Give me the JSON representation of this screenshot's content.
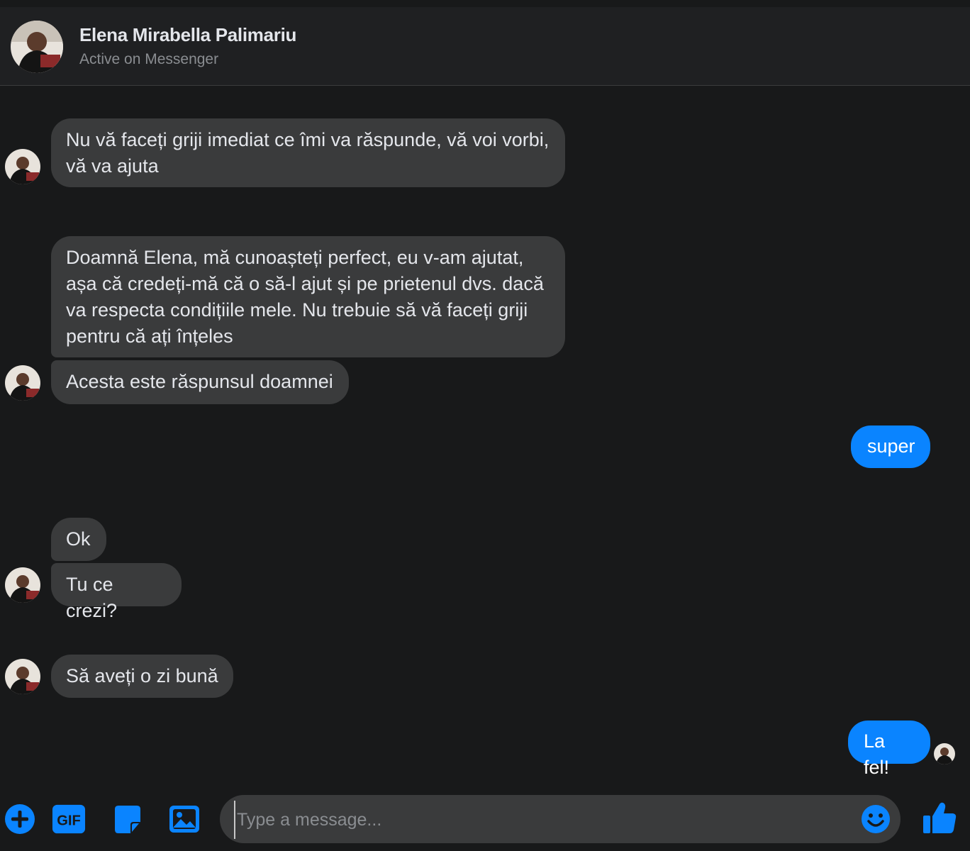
{
  "header": {
    "name": "Elena Mirabella Palimariu",
    "status": "Active on Messenger"
  },
  "messages": [
    {
      "direction": "in",
      "text": "Nu vă faceți griji imediat ce îmi va răspunde, vă voi vorbi, vă va ajuta"
    },
    {
      "direction": "in",
      "text": "Doamnă Elena, mă cunoașteți perfect, eu v-am ajutat, așa că credeți-mă că o să-l ajut și pe prietenul dvs. dacă va respecta condițiile mele. Nu trebuie să vă faceți griji pentru că ați înțeles"
    },
    {
      "direction": "in",
      "text": "Acesta este răspunsul doamnei"
    },
    {
      "direction": "out",
      "text": "super"
    },
    {
      "direction": "in",
      "text": "Ok"
    },
    {
      "direction": "in",
      "text": "Tu ce crezi?"
    },
    {
      "direction": "in",
      "text": "Să aveți o zi bună"
    },
    {
      "direction": "out",
      "text": "La fel!"
    }
  ],
  "composer": {
    "placeholder": "Type a message...",
    "tools": [
      "plus-icon",
      "gif-icon",
      "sticker-icon",
      "image-icon"
    ],
    "gif_label": "GIF",
    "send_icon": "thumbs-up-icon",
    "emoji_icon": "emoji-icon"
  },
  "colors": {
    "background": "#18191a",
    "incoming_bubble": "#3a3b3c",
    "outgoing_bubble": "#0a84ff",
    "accent": "#0a84ff"
  }
}
